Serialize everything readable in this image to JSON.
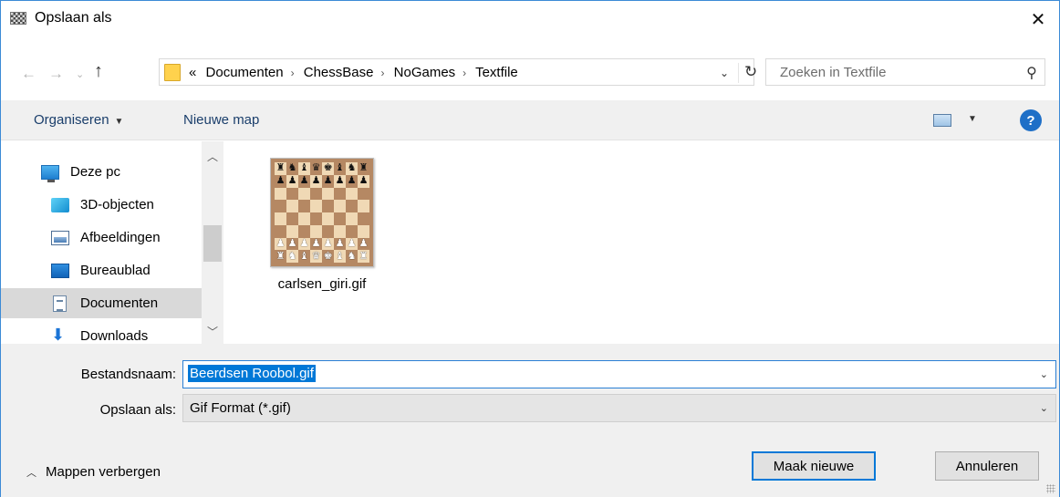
{
  "window": {
    "title": "Opslaan als",
    "close_glyph": "✕"
  },
  "navigation": {
    "back_glyph": "←",
    "forward_glyph": "→",
    "recent_glyph": "⌄",
    "up_glyph": "↑",
    "breadcrumb_prefix": "«",
    "breadcrumbs": [
      "Documenten",
      "ChessBase",
      "NoGames",
      "Textfile"
    ],
    "separator": "›",
    "search_placeholder": "Zoeken in Textfile"
  },
  "toolbar": {
    "organise_label": "Organiseren",
    "new_folder_label": "Nieuwe map",
    "help_label": "?"
  },
  "sidebar": {
    "items": [
      {
        "label": "Deze pc",
        "icon": "computer-icon"
      },
      {
        "label": "3D-objecten",
        "icon": "3d-objects-icon"
      },
      {
        "label": "Afbeeldingen",
        "icon": "pictures-icon"
      },
      {
        "label": "Bureaublad",
        "icon": "desktop-icon"
      },
      {
        "label": "Documenten",
        "icon": "documents-icon",
        "selected": true
      },
      {
        "label": "Downloads",
        "icon": "downloads-icon"
      }
    ]
  },
  "files": [
    {
      "name": "carlsen_giri.gif",
      "thumbnail": "chess-board-thumbnail",
      "board": [
        "rnbqkbnr",
        "pppppppp",
        "........",
        "........",
        "........",
        "........",
        "PPPPPPPP",
        "RNBQKBNR"
      ]
    }
  ],
  "form": {
    "filename_label": "Bestandsnaam:",
    "filename_value": "Beerdsen Roobol.gif",
    "filetype_label": "Opslaan als:",
    "filetype_value": "Gif Format (*.gif)"
  },
  "footer": {
    "hide_folders_label": "Mappen verbergen",
    "primary_button": "Maak nieuwe",
    "cancel_button": "Annuleren"
  },
  "colors": {
    "accent": "#0078d7",
    "window_border": "#3c8ad6",
    "panel_bg": "#f0f0f0",
    "selection_bg": "#d9d9d9",
    "help_icon": "#1e6fc7"
  }
}
